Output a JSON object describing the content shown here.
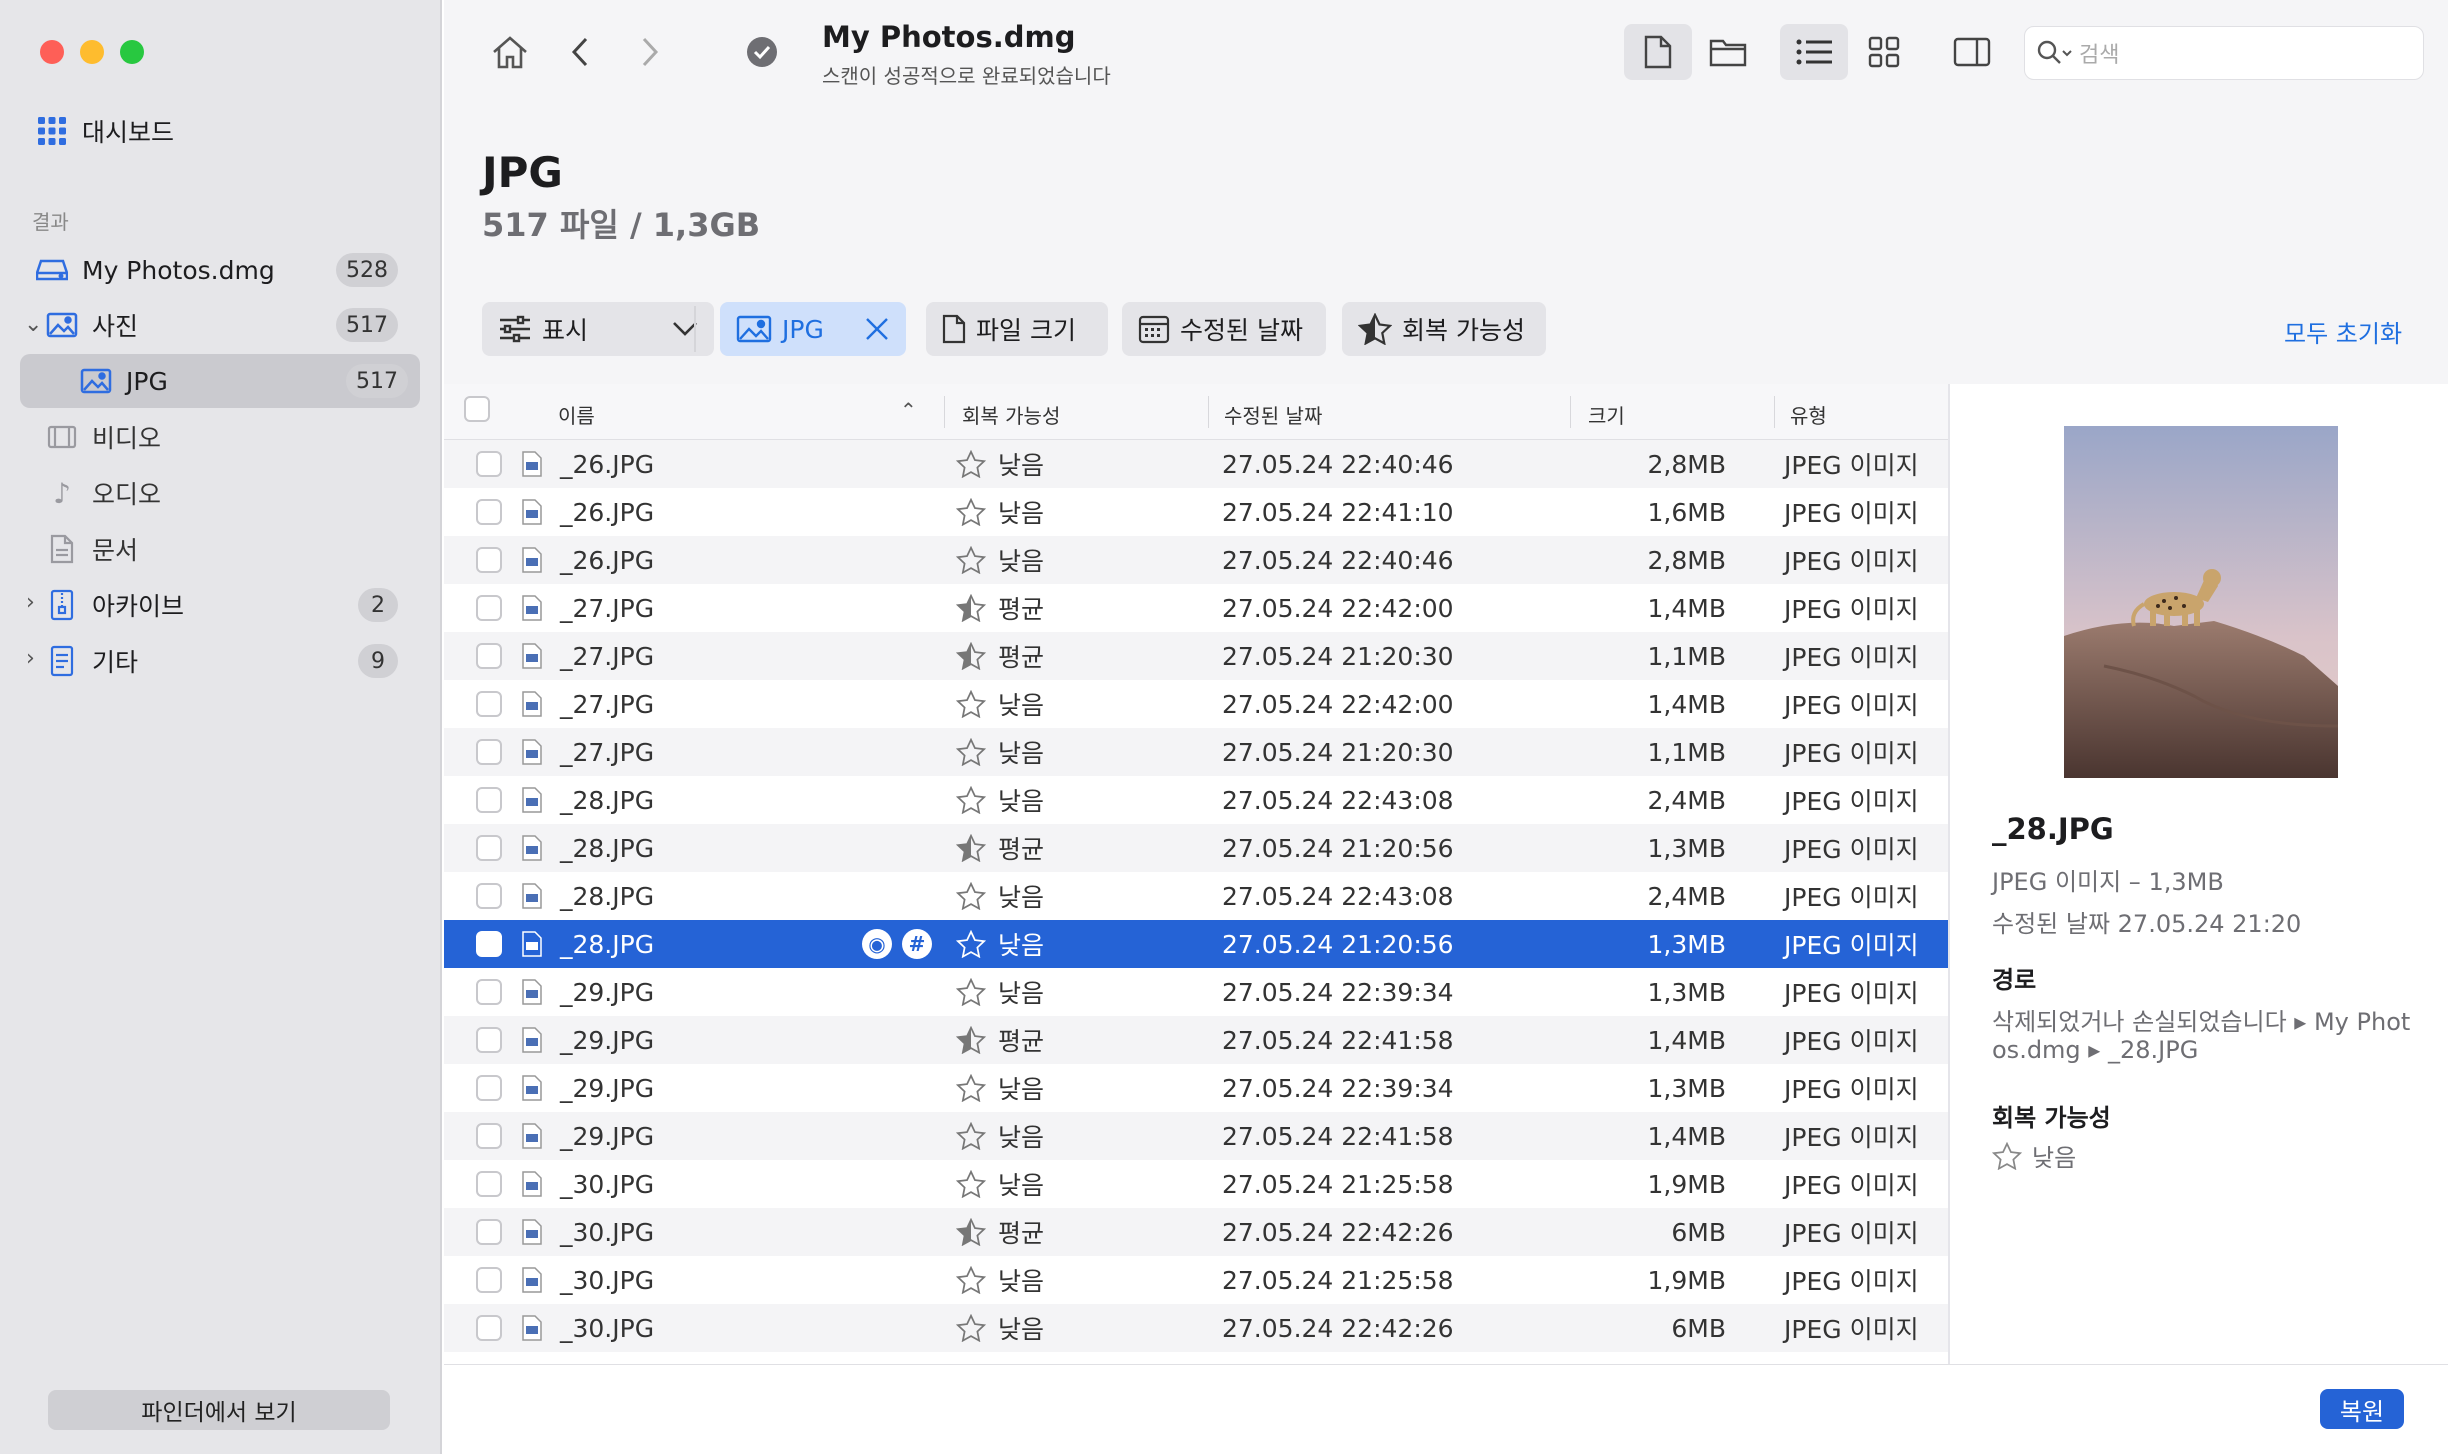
{
  "sidebar": {
    "dashboard": "대시보드",
    "section_results": "결과",
    "items": [
      {
        "label": "My Photos.dmg",
        "count": "528"
      },
      {
        "label": "사진",
        "count": "517"
      },
      {
        "label": "JPG",
        "count": "517"
      },
      {
        "label": "비디오",
        "count": ""
      },
      {
        "label": "오디오",
        "count": ""
      },
      {
        "label": "문서",
        "count": ""
      },
      {
        "label": "아카이브",
        "count": "2"
      },
      {
        "label": "기타",
        "count": "9"
      }
    ],
    "finder_button": "파인더에서 보기"
  },
  "toolbar": {
    "title": "My Photos.dmg",
    "subtitle": "스캔이 성공적으로 완료되었습니다",
    "search_placeholder": "검색"
  },
  "page": {
    "title": "JPG",
    "count": "517 파일 / 1,3GB"
  },
  "filters": {
    "show": "표시",
    "jpg": "JPG",
    "size": "파일 크기",
    "modified": "수정된 날짜",
    "recovery": "회복 가능성",
    "reset_all": "모두 초기화"
  },
  "table": {
    "headers": {
      "name": "이름",
      "recovery": "회복 가능성",
      "date": "수정된 날짜",
      "size": "크기",
      "type": "유형"
    },
    "rows": [
      {
        "name": "_26.JPG",
        "recovery": "낮음",
        "date": "27.05.24 22:40:46",
        "size": "2,8MB",
        "type": "JPEG 이미지"
      },
      {
        "name": "_26.JPG",
        "recovery": "낮음",
        "date": "27.05.24 22:41:10",
        "size": "1,6MB",
        "type": "JPEG 이미지"
      },
      {
        "name": "_26.JPG",
        "recovery": "낮음",
        "date": "27.05.24 22:40:46",
        "size": "2,8MB",
        "type": "JPEG 이미지"
      },
      {
        "name": "_27.JPG",
        "recovery": "평균",
        "date": "27.05.24 22:42:00",
        "size": "1,4MB",
        "type": "JPEG 이미지"
      },
      {
        "name": "_27.JPG",
        "recovery": "평균",
        "date": "27.05.24 21:20:30",
        "size": "1,1MB",
        "type": "JPEG 이미지"
      },
      {
        "name": "_27.JPG",
        "recovery": "낮음",
        "date": "27.05.24 22:42:00",
        "size": "1,4MB",
        "type": "JPEG 이미지"
      },
      {
        "name": "_27.JPG",
        "recovery": "낮음",
        "date": "27.05.24 21:20:30",
        "size": "1,1MB",
        "type": "JPEG 이미지"
      },
      {
        "name": "_28.JPG",
        "recovery": "낮음",
        "date": "27.05.24 22:43:08",
        "size": "2,4MB",
        "type": "JPEG 이미지"
      },
      {
        "name": "_28.JPG",
        "recovery": "평균",
        "date": "27.05.24 21:20:56",
        "size": "1,3MB",
        "type": "JPEG 이미지"
      },
      {
        "name": "_28.JPG",
        "recovery": "낮음",
        "date": "27.05.24 22:43:08",
        "size": "2,4MB",
        "type": "JPEG 이미지"
      },
      {
        "name": "_28.JPG",
        "recovery": "낮음",
        "date": "27.05.24 21:20:56",
        "size": "1,3MB",
        "type": "JPEG 이미지",
        "selected": true
      },
      {
        "name": "_29.JPG",
        "recovery": "낮음",
        "date": "27.05.24 22:39:34",
        "size": "1,3MB",
        "type": "JPEG 이미지"
      },
      {
        "name": "_29.JPG",
        "recovery": "평균",
        "date": "27.05.24 22:41:58",
        "size": "1,4MB",
        "type": "JPEG 이미지"
      },
      {
        "name": "_29.JPG",
        "recovery": "낮음",
        "date": "27.05.24 22:39:34",
        "size": "1,3MB",
        "type": "JPEG 이미지"
      },
      {
        "name": "_29.JPG",
        "recovery": "낮음",
        "date": "27.05.24 22:41:58",
        "size": "1,4MB",
        "type": "JPEG 이미지"
      },
      {
        "name": "_30.JPG",
        "recovery": "낮음",
        "date": "27.05.24 21:25:58",
        "size": "1,9MB",
        "type": "JPEG 이미지"
      },
      {
        "name": "_30.JPG",
        "recovery": "평균",
        "date": "27.05.24 22:42:26",
        "size": "6MB",
        "type": "JPEG 이미지"
      },
      {
        "name": "_30.JPG",
        "recovery": "낮음",
        "date": "27.05.24 21:25:58",
        "size": "1,9MB",
        "type": "JPEG 이미지"
      },
      {
        "name": "_30.JPG",
        "recovery": "낮음",
        "date": "27.05.24 22:42:26",
        "size": "6MB",
        "type": "JPEG 이미지"
      }
    ]
  },
  "details": {
    "name": "_28.JPG",
    "type_size": "JPEG 이미지 – 1,3MB",
    "modified": "수정된 날짜 27.05.24 21:20",
    "path_heading": "경로",
    "path_line1": "삭제되었거나 손실되었습니다 ▸ My Phot",
    "path_line2": "os.dmg ▸ _28.JPG",
    "recovery_heading": "회복 가능성",
    "recovery_value": "낮음"
  },
  "restore_button": "복원",
  "colors": {
    "accent": "#2563d6",
    "sidebar_bg": "#e6e6e9"
  }
}
